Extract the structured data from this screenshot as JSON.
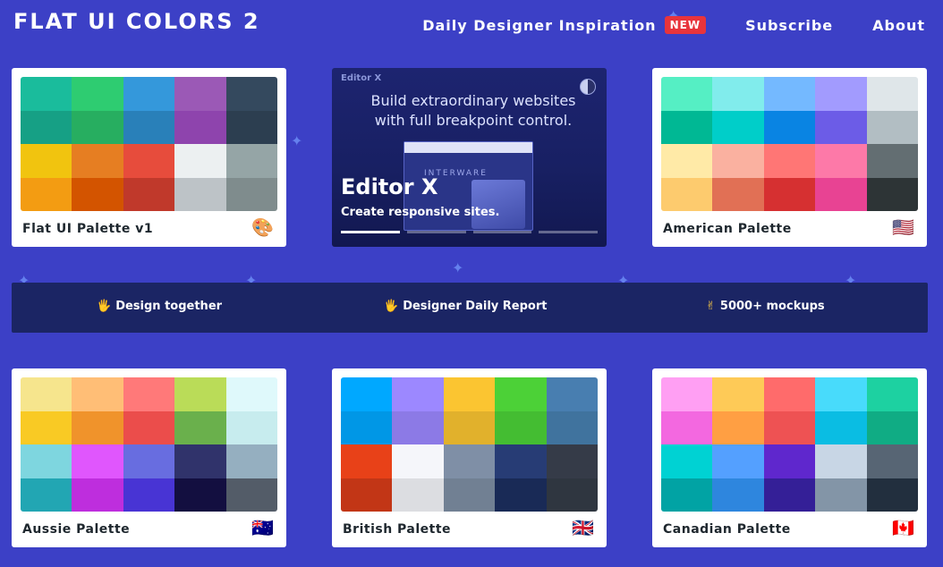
{
  "header": {
    "logo": "FLAT UI COLORS 2",
    "nav": {
      "inspiration": "Daily Designer Inspiration",
      "new_badge": "NEW",
      "subscribe": "Subscribe",
      "about": "About"
    }
  },
  "palettes": [
    {
      "name": "Flat UI Palette v1",
      "icon": "palette-icon",
      "glyph": "🎨",
      "colors": [
        "#1abc9c",
        "#2ecc71",
        "#3498db",
        "#9b59b6",
        "#34495e",
        "#16a085",
        "#27ae60",
        "#2980b9",
        "#8e44ad",
        "#2c3e50",
        "#f1c40f",
        "#e67e22",
        "#e74c3c",
        "#ecf0f1",
        "#95a5a6",
        "#f39c12",
        "#d35400",
        "#c0392b",
        "#bdc3c7",
        "#7f8c8d"
      ]
    },
    {
      "name": "American Palette",
      "icon": "us-flag-icon",
      "glyph": "🇺🇸",
      "colors": [
        "#55efc4",
        "#81ecec",
        "#74b9ff",
        "#a29bfe",
        "#dfe6e9",
        "#00b894",
        "#00cec9",
        "#0984e3",
        "#6c5ce7",
        "#b2bec3",
        "#ffeaa7",
        "#fab1a0",
        "#ff7675",
        "#fd79a8",
        "#636e72",
        "#fdcb6e",
        "#e17055",
        "#d63031",
        "#e84393",
        "#2d3436"
      ]
    },
    {
      "name": "Aussie Palette",
      "icon": "au-flag-icon",
      "glyph": "🇦🇺",
      "colors": [
        "#f6e58d",
        "#ffbe76",
        "#ff7979",
        "#badc58",
        "#dff9fb",
        "#f9ca24",
        "#f0932b",
        "#eb4d4b",
        "#6ab04c",
        "#c7ecee",
        "#7ed6df",
        "#e056fd",
        "#686de0",
        "#30336b",
        "#95afc0",
        "#22a6b3",
        "#be2edd",
        "#4834d4",
        "#130f40",
        "#535c68"
      ]
    },
    {
      "name": "British Palette",
      "icon": "gb-flag-icon",
      "glyph": "🇬🇧",
      "colors": [
        "#00a8ff",
        "#9c88ff",
        "#fbc531",
        "#4cd137",
        "#487eb0",
        "#0097e6",
        "#8c7ae6",
        "#e1b12c",
        "#44bd32",
        "#40739e",
        "#e84118",
        "#f5f6fa",
        "#7f8fa6",
        "#273c75",
        "#353b48",
        "#c23616",
        "#dcdde1",
        "#718093",
        "#192a56",
        "#2f3640"
      ]
    },
    {
      "name": "Canadian Palette",
      "icon": "ca-flag-icon",
      "glyph": "🇨🇦",
      "colors": [
        "#ff9ff3",
        "#feca57",
        "#ff6b6b",
        "#48dbfb",
        "#1dd1a1",
        "#f368e0",
        "#ff9f43",
        "#ee5253",
        "#0abde3",
        "#10ac84",
        "#00d2d3",
        "#54a0ff",
        "#5f27cd",
        "#c8d6e5",
        "#576574",
        "#01a3a4",
        "#2e86de",
        "#341f97",
        "#8395a7",
        "#222f3e"
      ]
    }
  ],
  "ad": {
    "brand": "Editor X",
    "tagline": "Build extraordinary websites with full breakpoint control.",
    "mock_label": "INTERWARE",
    "title": "Editor X",
    "subtitle": "Create responsive sites.",
    "slides_total": 4,
    "slide_active": 1
  },
  "banner": [
    {
      "emoji": "🖐",
      "label": "Design together"
    },
    {
      "emoji": "🖐",
      "label": "Designer Daily Report"
    },
    {
      "emoji": "✌",
      "label": "5000+ mockups"
    }
  ]
}
